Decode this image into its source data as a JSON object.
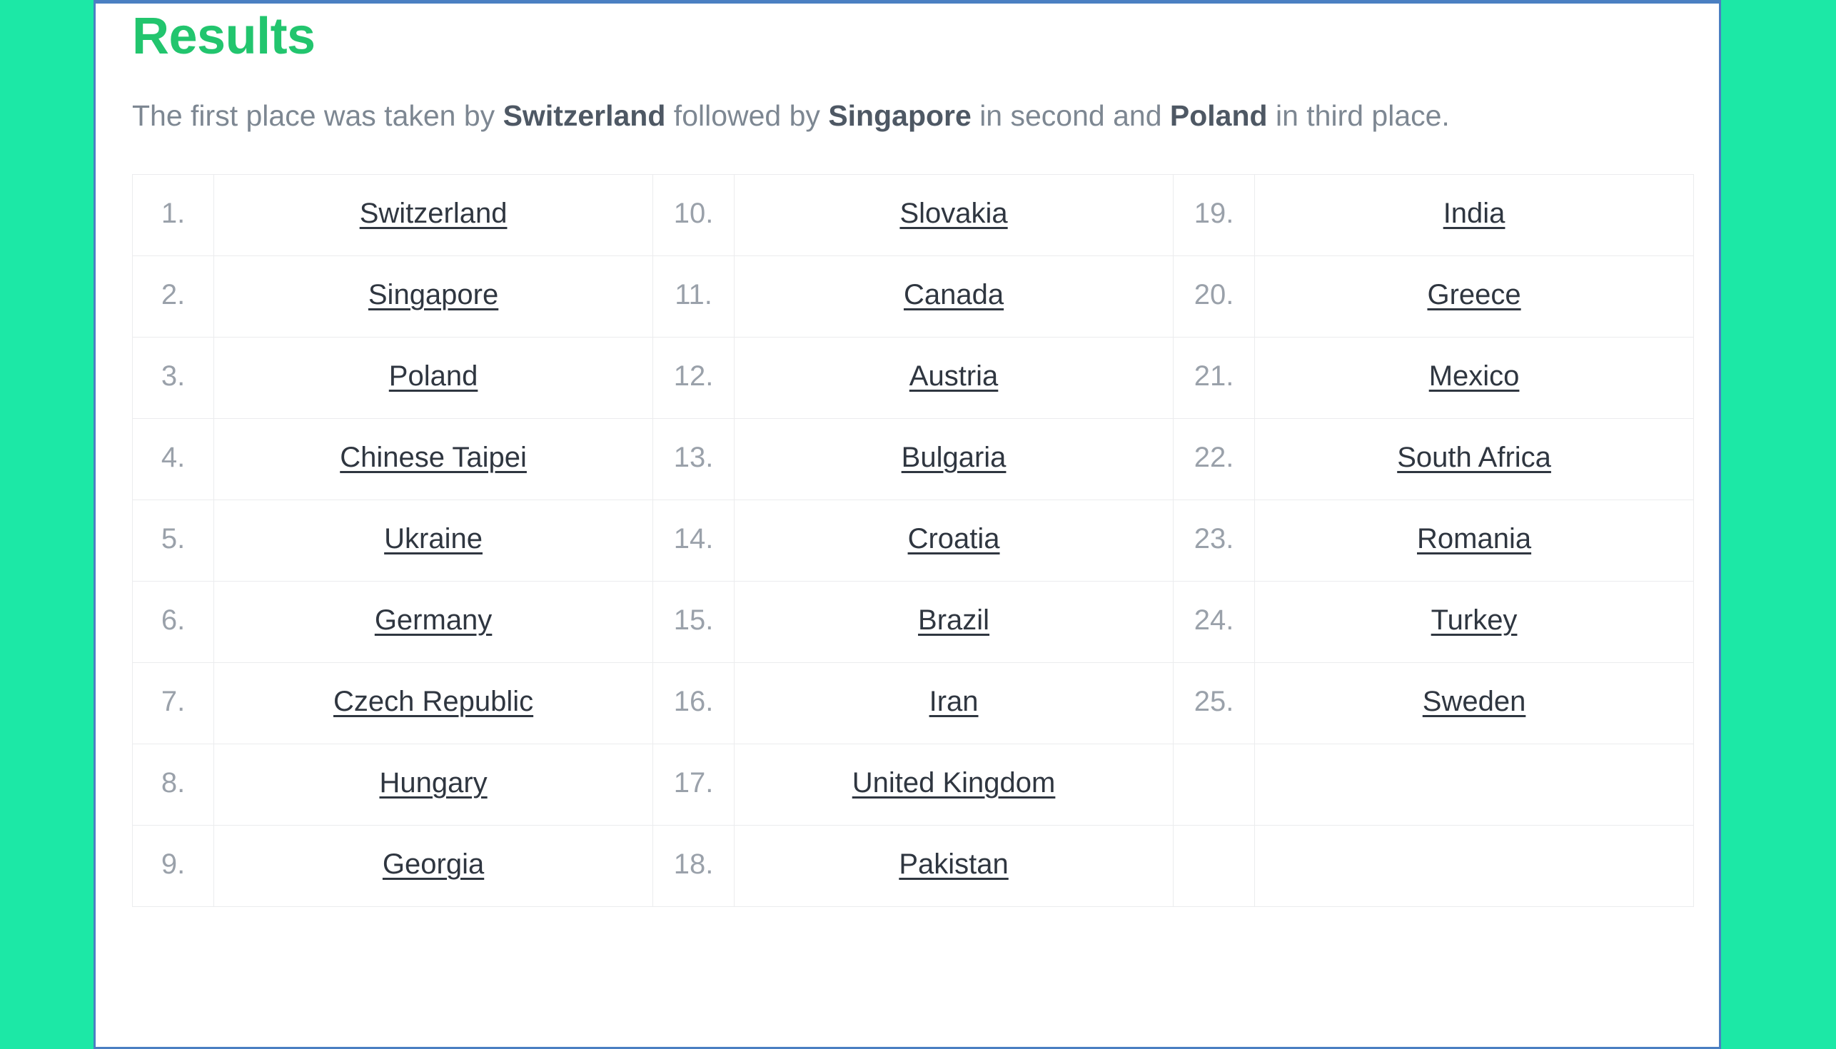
{
  "colors": {
    "page_background": "#1ce8a6",
    "panel_border": "#4a7fc2",
    "heading_green": "#22c56e",
    "body_text": "#7d8792",
    "strong_text": "#4e5864",
    "rank_number": "#9aa1aa",
    "link_text": "#2f3640",
    "table_border": "#ebecee"
  },
  "panel": {
    "heading": "Results",
    "summary": {
      "segments": [
        {
          "text": "The first place was taken by ",
          "bold": false
        },
        {
          "text": "Switzerland",
          "bold": true
        },
        {
          "text": " followed by ",
          "bold": false
        },
        {
          "text": "Singapore",
          "bold": true
        },
        {
          "text": " in second and ",
          "bold": false
        },
        {
          "text": "Poland",
          "bold": true
        },
        {
          "text": " in third place.",
          "bold": false
        }
      ],
      "plain": "The first place was taken by Switzerland followed by Singapore in second and Poland in third place."
    }
  },
  "ranking": {
    "columns": 3,
    "rows": 9,
    "entries": [
      {
        "rank": "1.",
        "country": "Switzerland"
      },
      {
        "rank": "2.",
        "country": "Singapore"
      },
      {
        "rank": "3.",
        "country": "Poland"
      },
      {
        "rank": "4.",
        "country": "Chinese Taipei"
      },
      {
        "rank": "5.",
        "country": "Ukraine"
      },
      {
        "rank": "6.",
        "country": "Germany"
      },
      {
        "rank": "7.",
        "country": "Czech Republic"
      },
      {
        "rank": "8.",
        "country": "Hungary"
      },
      {
        "rank": "9.",
        "country": "Georgia"
      },
      {
        "rank": "10.",
        "country": "Slovakia"
      },
      {
        "rank": "11.",
        "country": "Canada"
      },
      {
        "rank": "12.",
        "country": "Austria"
      },
      {
        "rank": "13.",
        "country": "Bulgaria"
      },
      {
        "rank": "14.",
        "country": "Croatia"
      },
      {
        "rank": "15.",
        "country": "Brazil"
      },
      {
        "rank": "16.",
        "country": "Iran"
      },
      {
        "rank": "17.",
        "country": "United Kingdom"
      },
      {
        "rank": "18.",
        "country": "Pakistan"
      },
      {
        "rank": "19.",
        "country": "India"
      },
      {
        "rank": "20.",
        "country": "Greece"
      },
      {
        "rank": "21.",
        "country": "Mexico"
      },
      {
        "rank": "22.",
        "country": "South Africa"
      },
      {
        "rank": "23.",
        "country": "Romania"
      },
      {
        "rank": "24.",
        "country": "Turkey"
      },
      {
        "rank": "25.",
        "country": "Sweden"
      }
    ]
  }
}
